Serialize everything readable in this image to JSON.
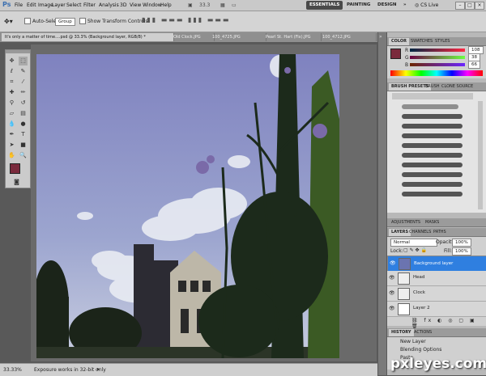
{
  "app": {
    "logo": "Ps",
    "zoom": "33.3"
  },
  "menubar": {
    "items": [
      "File",
      "Edit",
      "Image",
      "Layer",
      "Select",
      "Filter",
      "Analysis",
      "3D",
      "View",
      "Window",
      "Help"
    ],
    "workspaces": [
      "ESSENTIALS",
      "PAINTING",
      "DESIGN"
    ],
    "more_glyph": "»",
    "cslive": "CS Live"
  },
  "options": {
    "auto_select_label": "Auto-Select:",
    "auto_select_value": "Group",
    "transform_label": "Show Transform Controls"
  },
  "tabs": [
    {
      "label": "It's only a matter of time....psd @ 33.3% (Background layer, RGB/8) *",
      "active": true
    },
    {
      "label": "Old Clock.JPG",
      "active": false
    },
    {
      "label": "100_4725.JPG",
      "active": false
    },
    {
      "label": "Pearl St. Hart (Fix).JPG",
      "active": false
    },
    {
      "label": "100_4712.JPG",
      "active": false
    }
  ],
  "status": {
    "zoom": "33.33%",
    "info": "Exposure works in 32-bit only"
  },
  "panels": {
    "color": {
      "tabs": [
        "COLOR",
        "SWATCHES",
        "STYLES"
      ],
      "r": "108",
      "g": "38",
      "b": "66",
      "r_label": "R",
      "g_label": "G",
      "b_label": "B",
      "fg": "#7a2a3c"
    },
    "brush": {
      "tabs": [
        "BRUSH PRESETS",
        "BRUSH",
        "CLONE SOURCE"
      ]
    },
    "adjust": {
      "tabs": [
        "ADJUSTMENTS",
        "MASKS"
      ]
    },
    "layers": {
      "tabs": [
        "LAYERS",
        "CHANNELS",
        "PATHS"
      ],
      "blend": "Normal",
      "opacity_label": "Opacity:",
      "opacity": "100%",
      "lock_label": "Lock:",
      "fill_label": "Fill:",
      "fill": "100%",
      "rows": [
        {
          "name": "Background layer",
          "selected": true
        },
        {
          "name": "Head",
          "selected": false
        },
        {
          "name": "Clock",
          "selected": false
        },
        {
          "name": "Layer 2",
          "selected": false
        }
      ]
    },
    "history": {
      "tabs": [
        "HISTORY",
        "ACTIONS"
      ],
      "items": [
        "New Layer",
        "Blending Options",
        "Paste"
      ]
    }
  },
  "watermark": "pxleyes.com",
  "colors": {
    "accent": "#2f7fe0",
    "ui_bg": "#c9c9c9",
    "sky": "#7a7fb3"
  }
}
